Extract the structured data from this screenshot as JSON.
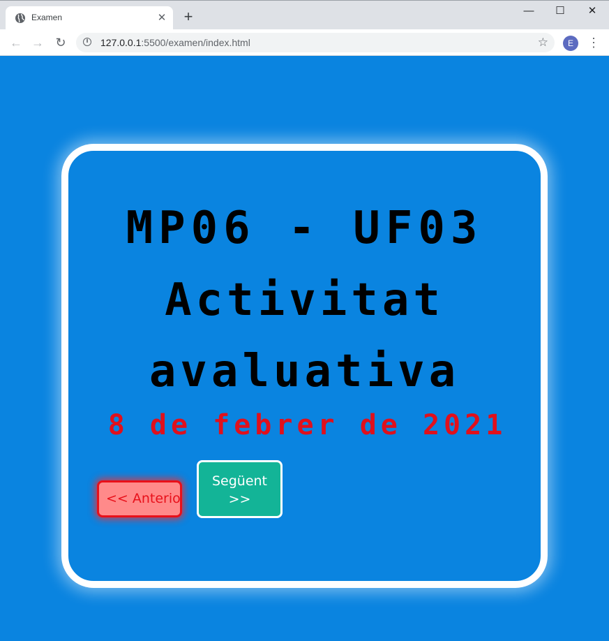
{
  "browser": {
    "tab_title": "Examen",
    "new_tab_label": "+",
    "url_host": "127.0.0.1",
    "url_path": ":5500/examen/index.html",
    "profile_initial": "E"
  },
  "page": {
    "heading_line1": "MP06 - UF03",
    "heading_line2": "Activitat",
    "heading_line3": "avaluativa",
    "date": "8 de febrer de 2021",
    "prev_button": "<< Anterior",
    "next_button_line1": "Següent",
    "next_button_line2": ">>"
  },
  "colors": {
    "page_background": "#0a84e0",
    "card_border": "#ffffff",
    "heading_text": "#000000",
    "date_text": "#e0101c",
    "prev_button_bg": "#ff8a8a",
    "prev_button_border": "#e8101a",
    "next_button_bg": "#13b497"
  }
}
